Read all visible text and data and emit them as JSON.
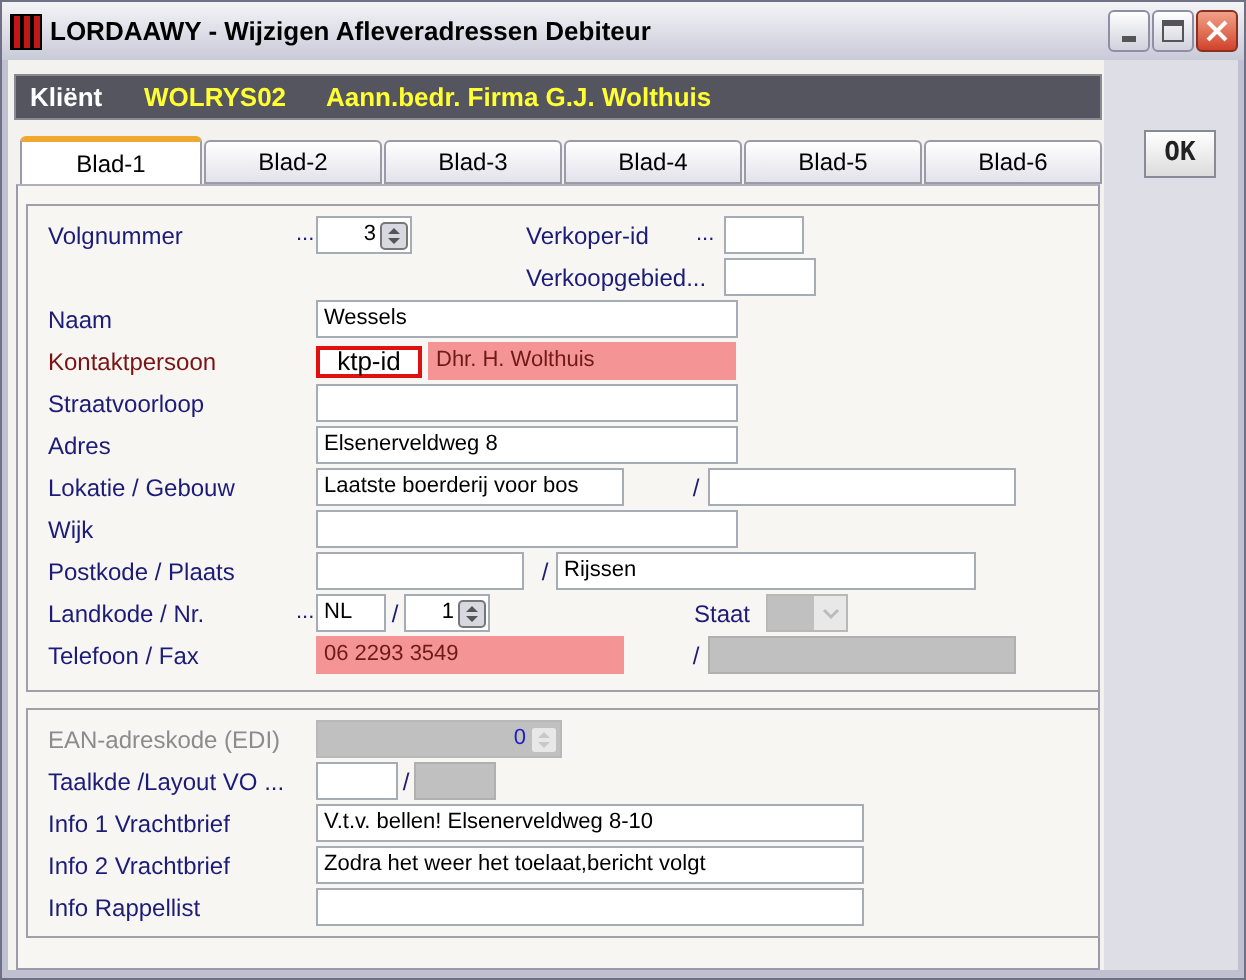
{
  "window": {
    "title": "LORDAAWY - Wijzigen Afleveradressen Debiteur"
  },
  "client": {
    "label": "Kliënt",
    "code": "WOLRYS02",
    "name": "Aann.bedr. Firma G.J. Wolthuis"
  },
  "tabs": [
    {
      "label": "Blad-1",
      "selected": true
    },
    {
      "label": "Blad-2",
      "selected": false
    },
    {
      "label": "Blad-3",
      "selected": false
    },
    {
      "label": "Blad-4",
      "selected": false
    },
    {
      "label": "Blad-5",
      "selected": false
    },
    {
      "label": "Blad-6",
      "selected": false
    }
  ],
  "ok_button": "OK",
  "section_1": [
    {
      "label": "Volgnummer",
      "highlighted": false,
      "disabled": false,
      "items": [
        {
          "kind": "dots",
          "text": "..."
        },
        {
          "kind": "spinner",
          "value": "3",
          "disabled": false
        },
        {
          "kind": "label",
          "text": "Verkoper-id"
        },
        {
          "kind": "dots",
          "text": "..."
        },
        {
          "kind": "field",
          "value": "",
          "highlighted": false,
          "disabled": false
        }
      ]
    },
    {
      "items": [
        {
          "kind": "label",
          "text": "Verkoopgebied..."
        },
        {
          "kind": "field",
          "value": "",
          "highlighted": false,
          "disabled": false
        }
      ]
    },
    {
      "label": "Naam",
      "highlighted": false,
      "disabled": false,
      "items": [
        {
          "kind": "field",
          "value": "Wessels",
          "highlighted": false,
          "disabled": false
        }
      ]
    },
    {
      "label": "Kontaktpersoon",
      "highlighted": true,
      "disabled": false,
      "items": [
        {
          "kind": "tag",
          "text": "ktp-id"
        },
        {
          "kind": "field",
          "value": "Dhr. H. Wolthuis",
          "highlighted": true,
          "disabled": false
        }
      ]
    },
    {
      "label": "Straatvoorloop",
      "highlighted": false,
      "disabled": false,
      "items": [
        {
          "kind": "field",
          "value": "",
          "highlighted": false,
          "disabled": false
        }
      ]
    },
    {
      "label": "Adres",
      "highlighted": false,
      "disabled": false,
      "items": [
        {
          "kind": "field",
          "value": "Elsenerveldweg 8",
          "highlighted": false,
          "disabled": false
        }
      ]
    },
    {
      "label": "Lokatie / Gebouw",
      "highlighted": false,
      "disabled": false,
      "items": [
        {
          "kind": "field",
          "value": "Laatste boerderij voor bos",
          "highlighted": false,
          "disabled": false
        },
        {
          "kind": "slash",
          "text": "/"
        },
        {
          "kind": "field",
          "value": "",
          "highlighted": false,
          "disabled": false
        }
      ]
    },
    {
      "label": "Wijk",
      "highlighted": false,
      "disabled": false,
      "items": [
        {
          "kind": "field",
          "value": "",
          "highlighted": false,
          "disabled": false
        }
      ]
    },
    {
      "label": "Postkode / Plaats",
      "highlighted": false,
      "disabled": false,
      "items": [
        {
          "kind": "field",
          "value": "",
          "highlighted": false,
          "disabled": false
        },
        {
          "kind": "slash",
          "text": "/"
        },
        {
          "kind": "field",
          "value": "Rijssen",
          "highlighted": false,
          "disabled": false
        }
      ]
    },
    {
      "label": "Landkode  / Nr.",
      "highlighted": false,
      "disabled": false,
      "items": [
        {
          "kind": "dots",
          "text": "..."
        },
        {
          "kind": "field",
          "value": "NL",
          "highlighted": false,
          "disabled": false
        },
        {
          "kind": "slash",
          "text": "/"
        },
        {
          "kind": "spinner",
          "value": "1",
          "disabled": false
        },
        {
          "kind": "label",
          "text": "Staat"
        },
        {
          "kind": "combo",
          "disabled": true
        }
      ]
    },
    {
      "label": "Telefoon / Fax",
      "highlighted": false,
      "disabled": false,
      "items": [
        {
          "kind": "field",
          "value": "06 2293 3549",
          "highlighted": true,
          "disabled": false
        },
        {
          "kind": "slash",
          "text": "/"
        },
        {
          "kind": "field",
          "value": "",
          "highlighted": false,
          "disabled": true
        }
      ]
    }
  ],
  "section_2": [
    {
      "label": "EAN-adreskode (EDI)",
      "highlighted": false,
      "disabled": true,
      "items": [
        {
          "kind": "spinner",
          "value": "0",
          "disabled": true
        }
      ]
    },
    {
      "label": "Taalkde /Layout VO ...",
      "highlighted": false,
      "disabled": false,
      "items": [
        {
          "kind": "field",
          "value": "",
          "highlighted": false,
          "disabled": false
        },
        {
          "kind": "slash",
          "text": "/"
        },
        {
          "kind": "field",
          "value": "",
          "highlighted": false,
          "disabled": true
        }
      ]
    },
    {
      "label": "Info 1 Vrachtbrief",
      "highlighted": false,
      "disabled": false,
      "items": [
        {
          "kind": "field",
          "value": "V.t.v. bellen! Elsenerveldweg 8-10",
          "highlighted": false,
          "disabled": false
        }
      ]
    },
    {
      "label": "Info 2 Vrachtbrief",
      "highlighted": false,
      "disabled": false,
      "items": [
        {
          "kind": "field",
          "value": "Zodra het weer het toelaat,bericht volgt",
          "highlighted": false,
          "disabled": false
        }
      ]
    },
    {
      "label": "Info Rappellist",
      "highlighted": false,
      "disabled": false,
      "items": [
        {
          "kind": "field",
          "value": "",
          "highlighted": false,
          "disabled": false
        }
      ]
    }
  ]
}
